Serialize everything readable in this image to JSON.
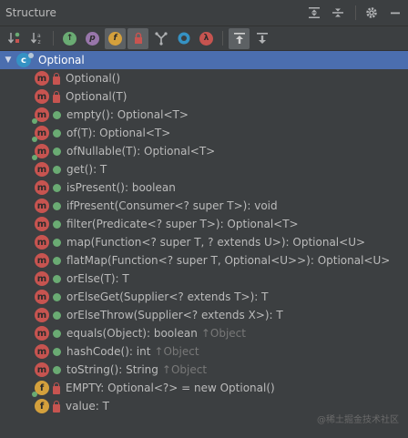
{
  "panel": {
    "title": "Structure"
  },
  "toolbar": {
    "buttons": [
      {
        "icon": "sort-by-visibility-icon"
      },
      {
        "icon": "sort-alphabetically-icon"
      },
      {
        "icon": "show-inherited-icon"
      },
      {
        "icon": "show-properties-icon",
        "glyph": "p"
      },
      {
        "icon": "show-fields-icon",
        "glyph": "f"
      },
      {
        "icon": "show-non-public-icon"
      },
      {
        "icon": "show-lambdas-icon"
      },
      {
        "icon": "show-anonymous-icon"
      },
      {
        "icon": "show-lambda-icon",
        "glyph": "λ"
      },
      {
        "icon": "autoscroll-to-source-icon"
      },
      {
        "icon": "autoscroll-from-source-icon"
      }
    ]
  },
  "tree": {
    "root": {
      "label": "Optional",
      "icon": "class-icon",
      "glyph": "c"
    },
    "members": [
      {
        "label": "Optional()",
        "kind": "m",
        "visibility": "private",
        "static": false,
        "inherited": ""
      },
      {
        "label": "Optional(T)",
        "kind": "m",
        "visibility": "private",
        "static": false,
        "inherited": ""
      },
      {
        "label": "empty(): Optional<T>",
        "kind": "m",
        "visibility": "public",
        "static": true,
        "inherited": ""
      },
      {
        "label": "of(T): Optional<T>",
        "kind": "m",
        "visibility": "public",
        "static": true,
        "inherited": ""
      },
      {
        "label": "ofNullable(T): Optional<T>",
        "kind": "m",
        "visibility": "public",
        "static": true,
        "inherited": ""
      },
      {
        "label": "get(): T",
        "kind": "m",
        "visibility": "public",
        "static": false,
        "inherited": ""
      },
      {
        "label": "isPresent(): boolean",
        "kind": "m",
        "visibility": "public",
        "static": false,
        "inherited": ""
      },
      {
        "label": "ifPresent(Consumer<? super T>): void",
        "kind": "m",
        "visibility": "public",
        "static": false,
        "inherited": ""
      },
      {
        "label": "filter(Predicate<? super T>): Optional<T>",
        "kind": "m",
        "visibility": "public",
        "static": false,
        "inherited": ""
      },
      {
        "label": "map(Function<? super T, ? extends U>): Optional<U>",
        "kind": "m",
        "visibility": "public",
        "static": false,
        "inherited": ""
      },
      {
        "label": "flatMap(Function<? super T, Optional<U>>): Optional<U>",
        "kind": "m",
        "visibility": "public",
        "static": false,
        "inherited": ""
      },
      {
        "label": "orElse(T): T",
        "kind": "m",
        "visibility": "public",
        "static": false,
        "inherited": ""
      },
      {
        "label": "orElseGet(Supplier<? extends T>): T",
        "kind": "m",
        "visibility": "public",
        "static": false,
        "inherited": ""
      },
      {
        "label": "orElseThrow(Supplier<? extends X>): T",
        "kind": "m",
        "visibility": "public",
        "static": false,
        "inherited": ""
      },
      {
        "label": "equals(Object): boolean",
        "kind": "m",
        "visibility": "public",
        "static": false,
        "inherited": "↑Object"
      },
      {
        "label": "hashCode(): int",
        "kind": "m",
        "visibility": "public",
        "static": false,
        "inherited": "↑Object"
      },
      {
        "label": "toString(): String",
        "kind": "m",
        "visibility": "public",
        "static": false,
        "inherited": "↑Object"
      },
      {
        "label": "EMPTY: Optional<?> = new Optional()",
        "kind": "f",
        "visibility": "private",
        "static": true,
        "inherited": ""
      },
      {
        "label": "value: T",
        "kind": "f",
        "visibility": "private",
        "static": false,
        "inherited": ""
      }
    ]
  },
  "watermark": "@稀土掘金技术社区"
}
